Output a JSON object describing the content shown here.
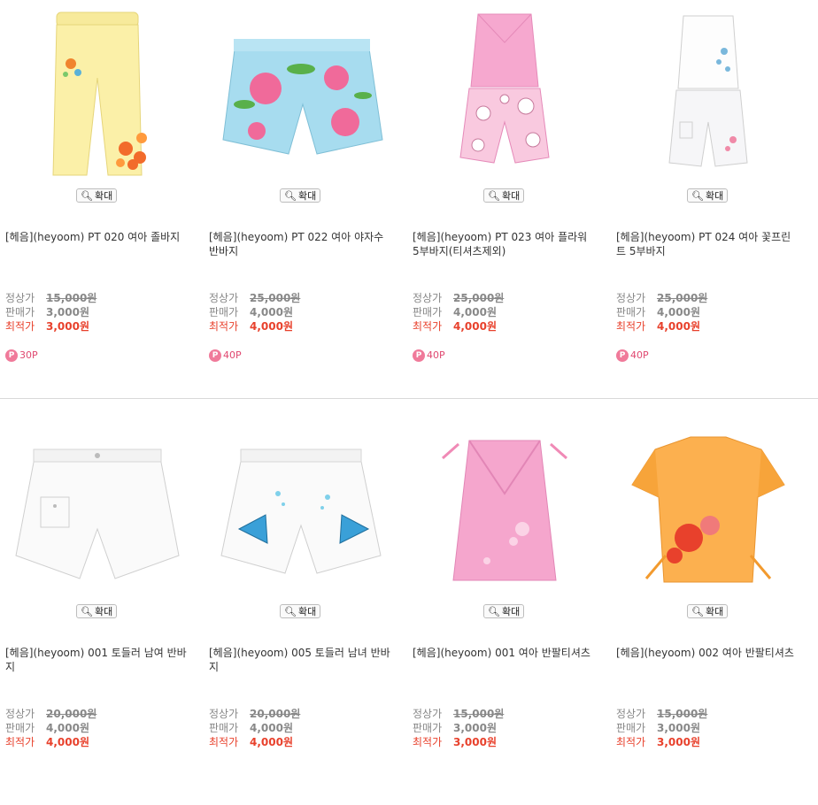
{
  "zoom_label": "확대",
  "labels": {
    "regular": "정상가",
    "sale": "판매가",
    "best": "최적가"
  },
  "products": [
    {
      "name": "[헤음](heyoom) PT 020 여아 졸바지",
      "regular": "15,000원",
      "sale": "3,000원",
      "best": "3,000원",
      "points": "30P",
      "illustration": "yellow-capri-pants"
    },
    {
      "name": "[헤음](heyoom) PT 022 여아 야자수 반바지",
      "regular": "25,000원",
      "sale": "4,000원",
      "best": "4,000원",
      "points": "40P",
      "illustration": "floral-blue-shorts"
    },
    {
      "name": "[헤음](heyoom) PT 023 여아 플라워 5부바지(티셔츠제외)",
      "regular": "25,000원",
      "sale": "4,000원",
      "best": "4,000원",
      "points": "40P",
      "illustration": "pink-top-floral-pants"
    },
    {
      "name": "[헤음](heyoom) PT 024 여아 꽃프린트 5부바지",
      "regular": "25,000원",
      "sale": "4,000원",
      "best": "4,000원",
      "points": "40P",
      "illustration": "white-top-white-pants"
    },
    {
      "name": "[헤음](heyoom) 001 토들러 남여 반바지",
      "regular": "20,000원",
      "sale": "4,000원",
      "best": "4,000원",
      "points": "",
      "illustration": "white-shorts"
    },
    {
      "name": "[헤음](heyoom) 005 토들러 남녀 반바지",
      "regular": "20,000원",
      "sale": "4,000원",
      "best": "4,000원",
      "points": "",
      "illustration": "white-fish-shorts"
    },
    {
      "name": "[헤음](heyoom) 001 여아 반팔티셔츠",
      "regular": "15,000원",
      "sale": "3,000원",
      "best": "3,000원",
      "points": "",
      "illustration": "pink-wrap-top"
    },
    {
      "name": "[헤음](heyoom) 002 여아 반팔티셔츠",
      "regular": "15,000원",
      "sale": "3,000원",
      "best": "3,000원",
      "points": "",
      "illustration": "orange-tee"
    }
  ],
  "colors": {
    "best_price": "#e8412c",
    "points": "#e04870",
    "divider": "#d9d9d9"
  }
}
